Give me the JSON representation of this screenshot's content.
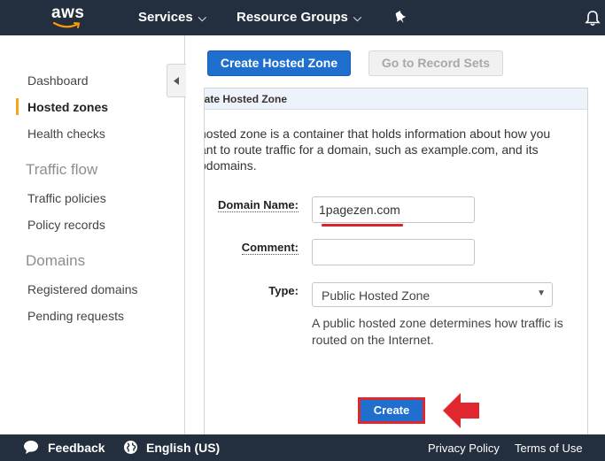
{
  "topnav": {
    "logo_text": "aws",
    "services_label": "Services",
    "resource_groups_label": "Resource Groups",
    "chevron_glyph": "⌄"
  },
  "sidebar": {
    "items": [
      {
        "label": "Dashboard",
        "active": false
      },
      {
        "label": "Hosted zones",
        "active": true
      },
      {
        "label": "Health checks",
        "active": false
      }
    ],
    "traffic_flow_heading": "Traffic flow",
    "traffic_flow_items": [
      "Traffic policies",
      "Policy records"
    ],
    "domains_heading": "Domains",
    "domains_items": [
      "Registered domains",
      "Pending requests"
    ]
  },
  "toolbar": {
    "create_label": "Create Hosted Zone",
    "goto_label": "Go to Record Sets"
  },
  "panel": {
    "title": "eate Hosted Zone",
    "description_lines": [
      "hosted zone is a container that holds information about how you",
      "ant to route traffic for a domain, such as example.com, and its",
      "bdomains."
    ],
    "domain_label": "Domain Name:",
    "domain_value": "1pagezen.com",
    "comment_label": "Comment:",
    "comment_value": "",
    "type_label": "Type:",
    "type_value": "Public Hosted Zone",
    "type_caret": "▼",
    "help_text": "A public hosted zone determines how traffic is routed on the Internet.",
    "create_button": "Create"
  },
  "footer": {
    "feedback_label": "Feedback",
    "language_label": "English (US)",
    "privacy_label": "Privacy Policy",
    "terms_label": "Terms of Use"
  },
  "colors": {
    "nav_bg": "#232f3e",
    "primary": "#1f6fcf",
    "annotation_red": "#e0262e",
    "active_accent": "#f7a51f"
  }
}
